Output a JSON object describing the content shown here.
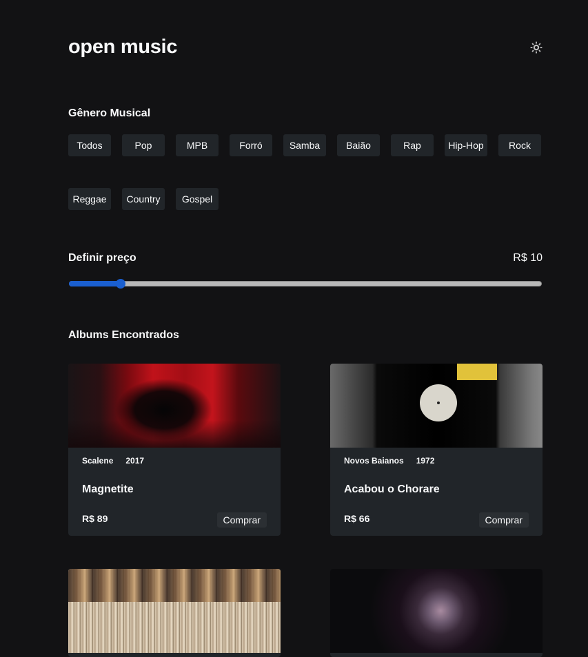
{
  "app": {
    "title": "open music",
    "theme_icon": "sun-icon"
  },
  "genre_section": {
    "title": "Gênero Musical",
    "genres": [
      "Todos",
      "Pop",
      "MPB",
      "Forró",
      "Samba",
      "Baião",
      "Rap",
      "Hip-Hop",
      "Rock",
      "Reggae",
      "Country",
      "Gospel"
    ]
  },
  "price_filter": {
    "title": "Definir preço",
    "value_label": "R$ 10",
    "slider_fraction": 0.11
  },
  "albums_section": {
    "title": "Albums Encontrados"
  },
  "albums": [
    {
      "artist": "Scalene",
      "year": "2017",
      "title": "Magnetite",
      "price": "R$ 89",
      "buy_label": "Comprar"
    },
    {
      "artist": "Novos Baianos",
      "year": "1972",
      "title": "Acabou o Chorare",
      "price": "R$ 66",
      "buy_label": "Comprar"
    }
  ],
  "colors": {
    "background": "#121214",
    "card": "#212529",
    "accent": "#1a5fd0",
    "text": "#f8f9fa"
  }
}
